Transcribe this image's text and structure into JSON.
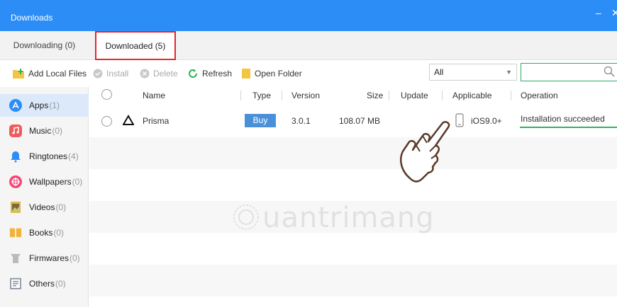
{
  "window": {
    "title": "Downloads",
    "minimize_glyph": "–",
    "close_glyph": "✕"
  },
  "tabs": [
    {
      "label": "Downloading (0)",
      "active": false
    },
    {
      "label": "Downloaded (5)",
      "active": true
    }
  ],
  "toolbar": {
    "add_local_files": "Add Local Files",
    "install": "Install",
    "delete": "Delete",
    "refresh": "Refresh",
    "open_folder": "Open Folder",
    "filter_value": "All",
    "search_value": ""
  },
  "sidebar": {
    "items": [
      {
        "label": "Apps",
        "count": "(1)",
        "icon": "apps-icon",
        "color": "#2d8df6"
      },
      {
        "label": "Music",
        "count": "(0)",
        "icon": "music-icon",
        "color": "#ef5a5a"
      },
      {
        "label": "Ringtones",
        "count": "(4)",
        "icon": "bell-icon",
        "color": "#2d8df6"
      },
      {
        "label": "Wallpapers",
        "count": "(0)",
        "icon": "wallpaper-icon",
        "color": "#ee4b7c"
      },
      {
        "label": "Videos",
        "count": "(0)",
        "icon": "video-icon",
        "color": "#e2b84a"
      },
      {
        "label": "Books",
        "count": "(0)",
        "icon": "book-icon",
        "color": "#f2b33c"
      },
      {
        "label": "Firmwares",
        "count": "(0)",
        "icon": "firmware-icon",
        "color": "#9aa0a6"
      },
      {
        "label": "Others",
        "count": "(0)",
        "icon": "others-icon",
        "color": "#6b7b8c"
      }
    ]
  },
  "table": {
    "headers": [
      "Name",
      "Type",
      "Version",
      "Size",
      "Update",
      "Applicable",
      "Operation"
    ],
    "rows": [
      {
        "name": "Prisma",
        "type": "Buy",
        "version": "3.0.1",
        "size": "108.07 MB",
        "update": "",
        "applicable": "iOS9.0+",
        "operation": "Installation succeeded"
      }
    ]
  },
  "watermark": {
    "text": "uantrimang"
  },
  "colors": {
    "accent": "#2d8df6",
    "success": "#2bb55a",
    "highlight_border": "#e8262a"
  }
}
